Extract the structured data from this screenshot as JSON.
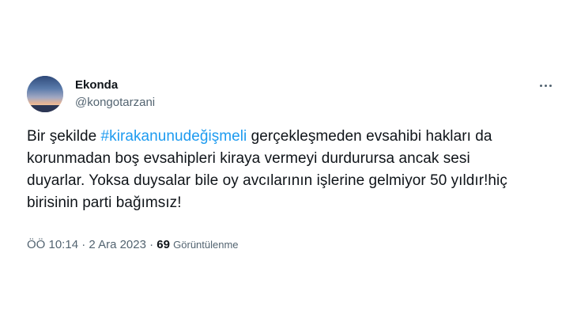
{
  "user": {
    "display_name": "Ekonda",
    "handle": "@kongotarzani"
  },
  "tweet": {
    "line1_pre": "Bir şekilde ",
    "hashtag": "#kirakanunudeğişmeli",
    "line1_post": " gerçekleşmeden evsahibi hakları da",
    "line2": "korunmadan boş evsahipleri kiraya vermeyi durdurursa ancak sesi",
    "line3": "duyarlar. Yoksa duysalar bile oy avcılarının işlerine gelmiyor 50 yıldır!hiç",
    "line4": "birisinin parti bağımsız!"
  },
  "meta": {
    "time": "ÖÖ 10:14",
    "separator1": " · ",
    "date": "2 Ara 2023",
    "separator2": " · ",
    "views_count": "69",
    "views_label": "Görüntülenme"
  },
  "icons": {
    "more": "more-icon"
  },
  "colors": {
    "hashtag": "#1d9bf0",
    "secondary_text": "#536471",
    "primary_text": "#0f1419"
  }
}
